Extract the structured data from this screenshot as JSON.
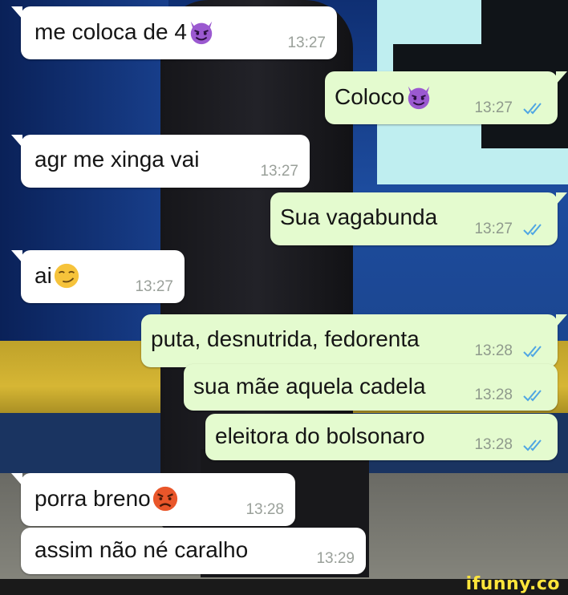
{
  "messages": [
    {
      "text": "me coloca de 4",
      "emoji": "smiling-devil-emoji",
      "time": "13:27",
      "direction": "incoming"
    },
    {
      "text": "Coloco",
      "emoji": "smiling-devil-emoji",
      "time": "13:27",
      "direction": "outgoing",
      "status": "read"
    },
    {
      "text": "agr me xinga vai",
      "time": "13:27",
      "direction": "incoming"
    },
    {
      "text": "Sua vagabunda",
      "time": "13:27",
      "direction": "outgoing",
      "status": "read"
    },
    {
      "text": "ai",
      "emoji": "smirk-emoji",
      "time": "13:27",
      "direction": "incoming"
    },
    {
      "text": "puta, desnutrida, fedorenta",
      "time": "13:28",
      "direction": "outgoing",
      "status": "read"
    },
    {
      "text": "sua mãe aquela cadela",
      "time": "13:28",
      "direction": "outgoing",
      "status": "read"
    },
    {
      "text": "eleitora do bolsonaro",
      "time": "13:28",
      "direction": "outgoing",
      "status": "read"
    },
    {
      "text": "porra breno",
      "emoji": "angry-face-emoji",
      "time": "13:28",
      "direction": "incoming"
    },
    {
      "text": "assim não né caralho",
      "time": "13:29",
      "direction": "incoming"
    }
  ],
  "watermark": {
    "text": "ifunny.co"
  },
  "colors": {
    "incoming_bubble": "#ffffff",
    "outgoing_bubble": "#e4fbcf",
    "read_ticks": "#4fa6e3",
    "watermark": "#ffe53b"
  }
}
